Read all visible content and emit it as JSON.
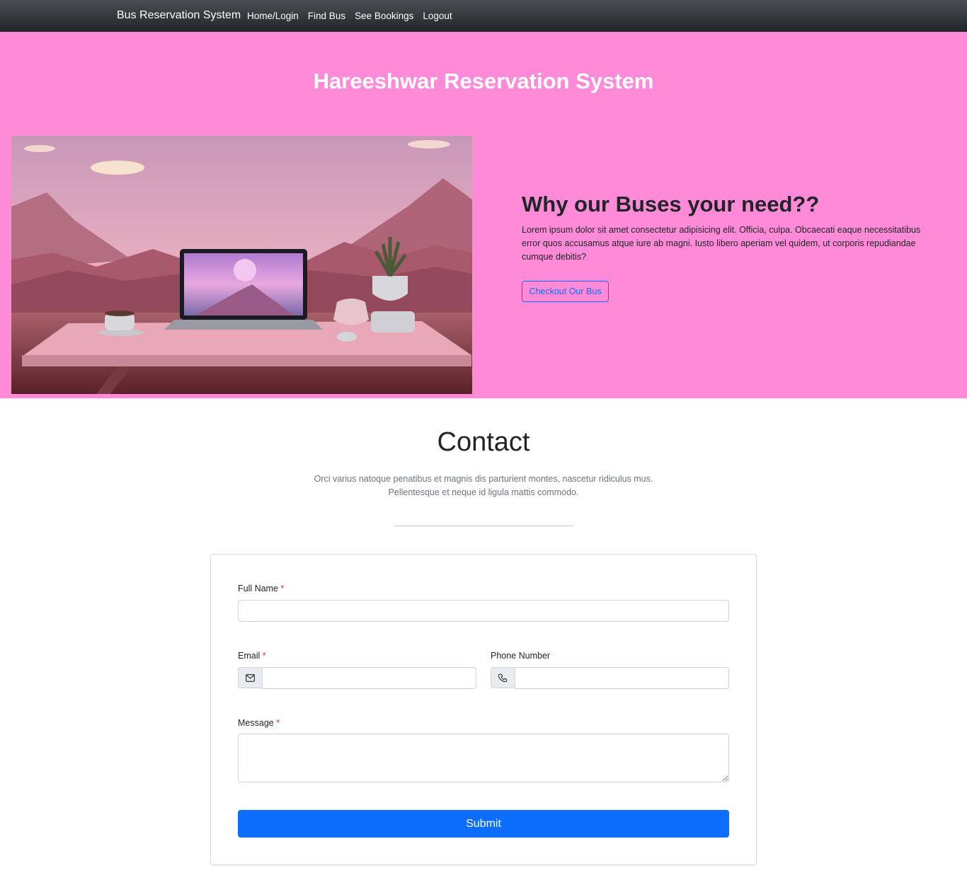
{
  "navbar": {
    "brand": "Bus Reservation System",
    "links": [
      "Home/Login",
      "Find Bus",
      "See Bookings",
      "Logout"
    ]
  },
  "hero": {
    "title": "Hareeshwar Reservation System",
    "why_title": "Why our Buses your need??",
    "why_text": "Lorem ipsum dolor sit amet consectetur adipisicing elit. Officia, culpa. Obcaecati eaque necessitatibus error quos accusamus atque iure ab magni. Iusto libero aperiam vel quidem, ut corporis repudiandae cumque debitis?",
    "button": "Checkout Our Bus"
  },
  "contact": {
    "title": "Contact",
    "subtitle_line1": "Orci varius natoque penatibus et magnis dis parturient montes, nascetur ridiculus mus.",
    "subtitle_line2": "Pellentesque et neque id ligula mattis commodo.",
    "form": {
      "full_name_label": "Full Name",
      "email_label": "Email",
      "phone_label": "Phone Number",
      "message_label": "Message",
      "required_mark": "*",
      "full_name_value": "",
      "email_value": "",
      "phone_value": "",
      "message_value": "",
      "email_icon": "envelope-icon",
      "phone_icon": "phone-icon",
      "submit": "Submit"
    }
  },
  "colors": {
    "hero_bg": "#ff8ad8",
    "primary": "#0d6efd",
    "navbar": "#212529",
    "required": "#dc3545"
  }
}
